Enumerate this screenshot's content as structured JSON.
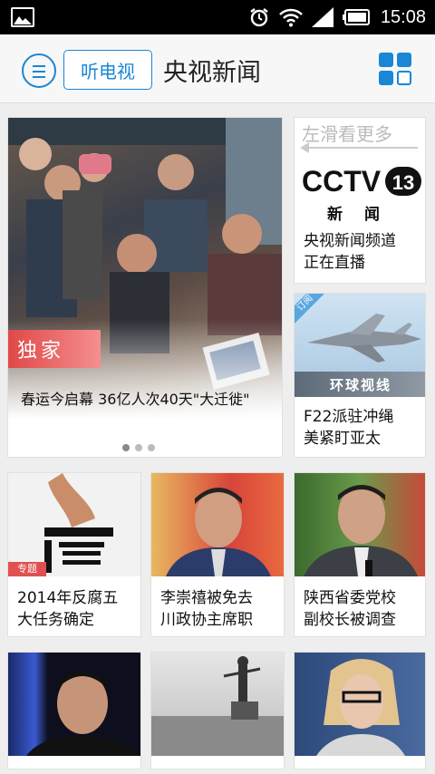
{
  "status_bar": {
    "time": "15:08"
  },
  "header": {
    "listen_tv_label": "听电视",
    "title": "央视新闻"
  },
  "colors": {
    "accent": "#1a86d6",
    "exclusive_badge": "#e04848"
  },
  "icons": {
    "status_left": "gallery-icon",
    "status_right": [
      "alarm-icon",
      "wifi-icon",
      "signal-icon",
      "battery-icon"
    ],
    "menu": "menu-icon",
    "grid": "grid-view-icon"
  },
  "featured": {
    "badge": "独家",
    "caption": "春运今启幕 36亿人次40天\"大迁徙\"",
    "carousel_pages": 3,
    "carousel_active": 1
  },
  "side_cards": [
    {
      "hint": "左滑看更多",
      "logo_text": "CCTV",
      "logo_channel": "13",
      "logo_sub": "新闻",
      "line1": "央视新闻频道",
      "line2": "正在直播"
    },
    {
      "corner_tag": "订阅",
      "banner": "环球视线",
      "line1": "F22派驻冲绳",
      "line2": "美紧盯亚太"
    }
  ],
  "grid_cards": [
    {
      "tag": "专题",
      "line1": "2014年反腐五",
      "line2": "大任务确定"
    },
    {
      "line1": "李崇禧被免去",
      "line2": "川政协主席职"
    },
    {
      "line1": "陕西省委党校",
      "line2": "副校长被调查"
    }
  ],
  "bottom_cards": 3
}
